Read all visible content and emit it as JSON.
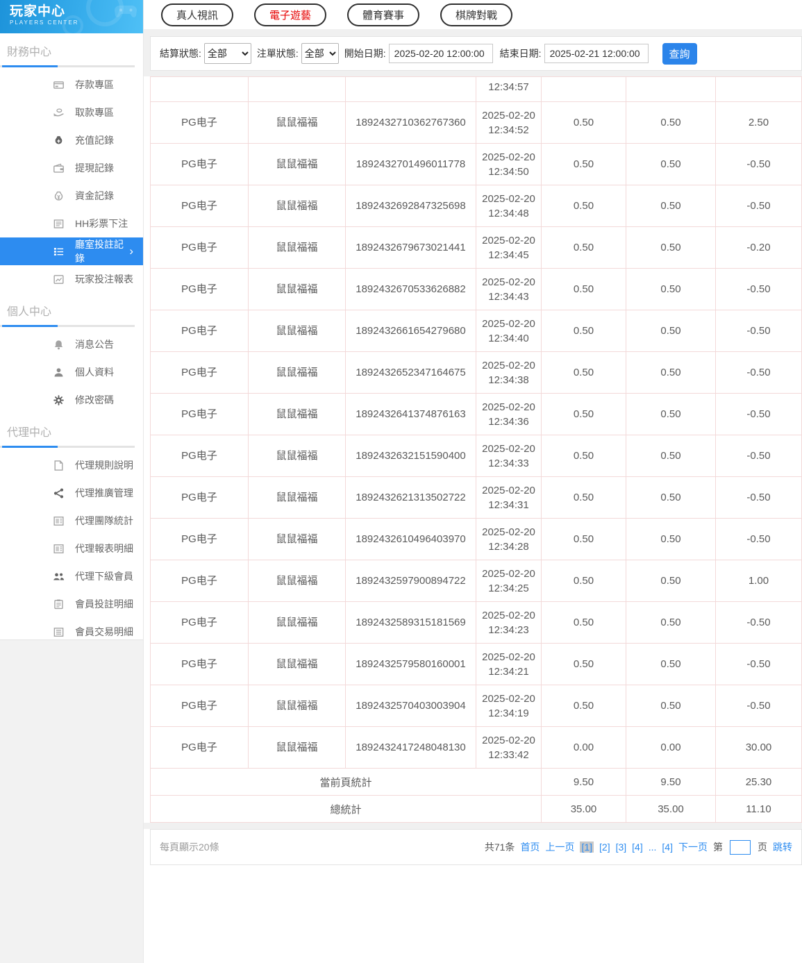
{
  "colors": {
    "accent": "#2d8cf0",
    "active_tab_text": "#e60000",
    "sidebar_active_bg": "#2d8cf0"
  },
  "sidebar": {
    "logo_title": "玩家中心",
    "logo_subtitle": "PLAYERS CENTER",
    "sections": [
      {
        "title": "財務中心",
        "items": [
          {
            "label": "存款專區",
            "icon": "deposit-icon"
          },
          {
            "label": "取款專區",
            "icon": "withdraw-icon"
          },
          {
            "label": "充值記錄",
            "icon": "recharge-record-icon"
          },
          {
            "label": "提現記錄",
            "icon": "withdrawal-record-icon"
          },
          {
            "label": "資金記錄",
            "icon": "funds-record-icon"
          },
          {
            "label": "HH彩票下注",
            "icon": "lottery-bet-icon"
          },
          {
            "label": "廳室投註記錄",
            "icon": "hall-bet-record-icon",
            "active": true
          },
          {
            "label": "玩家投注報表",
            "icon": "player-report-icon"
          }
        ]
      },
      {
        "title": "個人中心",
        "items": [
          {
            "label": "消息公告",
            "icon": "notice-bell-icon"
          },
          {
            "label": "個人資料",
            "icon": "profile-person-icon"
          },
          {
            "label": "修改密碼",
            "icon": "password-gear-icon"
          }
        ]
      },
      {
        "title": "代理中心",
        "items": [
          {
            "label": "代理規則說明",
            "icon": "agent-rules-doc-icon"
          },
          {
            "label": "代理推廣管理",
            "icon": "agent-promo-share-icon"
          },
          {
            "label": "代理團隊統計",
            "icon": "agent-team-report-icon"
          },
          {
            "label": "代理報表明細",
            "icon": "agent-report-detail-icon"
          },
          {
            "label": "代理下級會員",
            "icon": "agent-members-icon"
          },
          {
            "label": "會員投註明細",
            "icon": "member-bet-detail-icon"
          },
          {
            "label": "會員交易明細",
            "icon": "member-trans-detail-icon"
          }
        ]
      }
    ]
  },
  "tabs": [
    {
      "label": "真人視訊"
    },
    {
      "label": "電子遊藝",
      "active": true
    },
    {
      "label": "體育賽事"
    },
    {
      "label": "棋牌對戰"
    }
  ],
  "filters": {
    "settle_status_label": "結算狀態:",
    "settle_status_value": "全部",
    "order_status_label": "注單狀態:",
    "order_status_value": "全部",
    "start_date_label": "開始日期:",
    "start_date_value": "2025-02-20 12:00:00",
    "end_date_label": "結束日期:",
    "end_date_value": "2025-02-21 12:00:00",
    "search_label": "查詢"
  },
  "table": {
    "partial_row_time": "12:34:57",
    "rows": [
      {
        "provider": "PG电子",
        "game": "鼠鼠福福",
        "order_id": "1892432710362767360",
        "date": "2025-02-20",
        "time": "12:34:52",
        "bet": "0.50",
        "valid_bet": "0.50",
        "win_loss": "2.50"
      },
      {
        "provider": "PG电子",
        "game": "鼠鼠福福",
        "order_id": "1892432701496011778",
        "date": "2025-02-20",
        "time": "12:34:50",
        "bet": "0.50",
        "valid_bet": "0.50",
        "win_loss": "-0.50"
      },
      {
        "provider": "PG电子",
        "game": "鼠鼠福福",
        "order_id": "1892432692847325698",
        "date": "2025-02-20",
        "time": "12:34:48",
        "bet": "0.50",
        "valid_bet": "0.50",
        "win_loss": "-0.50"
      },
      {
        "provider": "PG电子",
        "game": "鼠鼠福福",
        "order_id": "1892432679673021441",
        "date": "2025-02-20",
        "time": "12:34:45",
        "bet": "0.50",
        "valid_bet": "0.50",
        "win_loss": "-0.20"
      },
      {
        "provider": "PG电子",
        "game": "鼠鼠福福",
        "order_id": "1892432670533626882",
        "date": "2025-02-20",
        "time": "12:34:43",
        "bet": "0.50",
        "valid_bet": "0.50",
        "win_loss": "-0.50"
      },
      {
        "provider": "PG电子",
        "game": "鼠鼠福福",
        "order_id": "1892432661654279680",
        "date": "2025-02-20",
        "time": "12:34:40",
        "bet": "0.50",
        "valid_bet": "0.50",
        "win_loss": "-0.50"
      },
      {
        "provider": "PG电子",
        "game": "鼠鼠福福",
        "order_id": "1892432652347164675",
        "date": "2025-02-20",
        "time": "12:34:38",
        "bet": "0.50",
        "valid_bet": "0.50",
        "win_loss": "-0.50"
      },
      {
        "provider": "PG电子",
        "game": "鼠鼠福福",
        "order_id": "1892432641374876163",
        "date": "2025-02-20",
        "time": "12:34:36",
        "bet": "0.50",
        "valid_bet": "0.50",
        "win_loss": "-0.50"
      },
      {
        "provider": "PG电子",
        "game": "鼠鼠福福",
        "order_id": "1892432632151590400",
        "date": "2025-02-20",
        "time": "12:34:33",
        "bet": "0.50",
        "valid_bet": "0.50",
        "win_loss": "-0.50"
      },
      {
        "provider": "PG电子",
        "game": "鼠鼠福福",
        "order_id": "1892432621313502722",
        "date": "2025-02-20",
        "time": "12:34:31",
        "bet": "0.50",
        "valid_bet": "0.50",
        "win_loss": "-0.50"
      },
      {
        "provider": "PG电子",
        "game": "鼠鼠福福",
        "order_id": "1892432610496403970",
        "date": "2025-02-20",
        "time": "12:34:28",
        "bet": "0.50",
        "valid_bet": "0.50",
        "win_loss": "-0.50"
      },
      {
        "provider": "PG电子",
        "game": "鼠鼠福福",
        "order_id": "1892432597900894722",
        "date": "2025-02-20",
        "time": "12:34:25",
        "bet": "0.50",
        "valid_bet": "0.50",
        "win_loss": "1.00"
      },
      {
        "provider": "PG电子",
        "game": "鼠鼠福福",
        "order_id": "1892432589315181569",
        "date": "2025-02-20",
        "time": "12:34:23",
        "bet": "0.50",
        "valid_bet": "0.50",
        "win_loss": "-0.50"
      },
      {
        "provider": "PG电子",
        "game": "鼠鼠福福",
        "order_id": "1892432579580160001",
        "date": "2025-02-20",
        "time": "12:34:21",
        "bet": "0.50",
        "valid_bet": "0.50",
        "win_loss": "-0.50"
      },
      {
        "provider": "PG电子",
        "game": "鼠鼠福福",
        "order_id": "1892432570403003904",
        "date": "2025-02-20",
        "time": "12:34:19",
        "bet": "0.50",
        "valid_bet": "0.50",
        "win_loss": "-0.50"
      },
      {
        "provider": "PG电子",
        "game": "鼠鼠福福",
        "order_id": "1892432417248048130",
        "date": "2025-02-20",
        "time": "12:33:42",
        "bet": "0.00",
        "valid_bet": "0.00",
        "win_loss": "30.00"
      }
    ],
    "page_summary": {
      "label": "當前頁統計",
      "bet": "9.50",
      "valid_bet": "9.50",
      "win_loss": "25.30"
    },
    "total_summary": {
      "label": "總統計",
      "bet": "35.00",
      "valid_bet": "35.00",
      "win_loss": "11.10"
    }
  },
  "pagination": {
    "per_page_text": "每頁顯示20條",
    "total_text": "共71条",
    "first_text": "首页",
    "prev_text": "上一页",
    "pages": [
      {
        "label": "[1]",
        "current": true
      },
      {
        "label": "[2]"
      },
      {
        "label": "[3]"
      },
      {
        "label": "[4]"
      },
      {
        "label": "...",
        "ellipsis": true
      },
      {
        "label": "[4]"
      }
    ],
    "next_text": "下一页",
    "jump_prefix": "第",
    "jump_suffix": "页",
    "jump_action": "跳转",
    "jump_value": ""
  }
}
